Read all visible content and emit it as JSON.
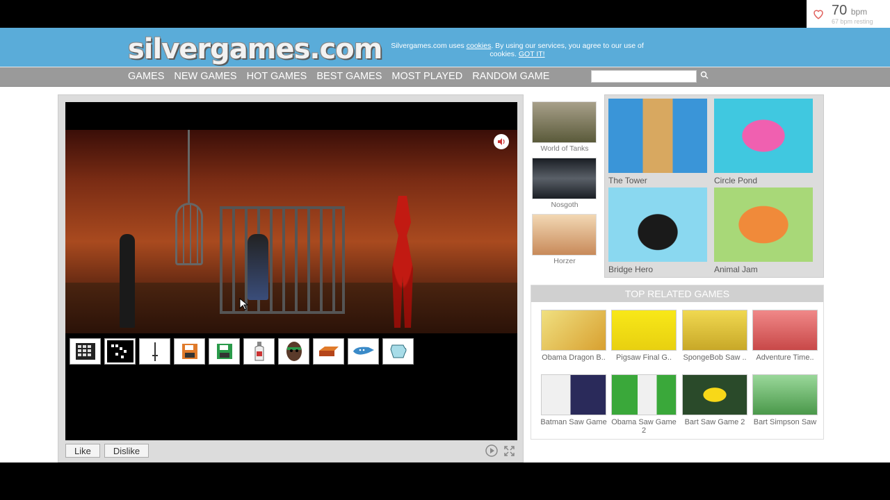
{
  "hr_widget": {
    "bpm": "70",
    "bpm_unit": "bpm",
    "resting": "67 bpm resting",
    "accent": "#e0605b"
  },
  "header": {
    "logo": "silvergames.com",
    "cookie_prefix": "Silvergames.com uses ",
    "cookie_link": "cookies",
    "cookie_middle": ". By using our services, you agree to our use of cookies.",
    "cookie_gotit": "GOT IT!"
  },
  "nav": {
    "items": [
      "GAMES",
      "NEW GAMES",
      "HOT GAMES",
      "BEST GAMES",
      "MOST PLAYED",
      "RANDOM GAME"
    ],
    "search_placeholder": ""
  },
  "game": {
    "like_label": "Like",
    "dislike_label": "Dislike",
    "inventory": [
      "grid-panel-icon",
      "crossword-icon",
      "knife-icon",
      "floppy-disk-orange-icon",
      "floppy-disk-green-icon",
      "bottle-icon",
      "mask-icon",
      "brick-icon",
      "ocarina-icon",
      "jug-icon"
    ]
  },
  "side_games": [
    {
      "label": "World of Tanks",
      "color": "#7a7d5c"
    },
    {
      "label": "Nosgoth",
      "color": "#3a4048"
    },
    {
      "label": "Horzer",
      "color": "#d9b08a"
    }
  ],
  "featured": [
    {
      "label": "The Tower",
      "color": "#4ba5e0"
    },
    {
      "label": "Circle Pond",
      "color": "#e84a9c"
    },
    {
      "label": "Bridge Hero",
      "color": "#7fcde8"
    },
    {
      "label": "Animal Jam",
      "color": "#e88a4a"
    }
  ],
  "related": {
    "title": "TOP RELATED GAMES",
    "items": [
      {
        "label": "Obama Dragon B..",
        "color": "#d9c46b"
      },
      {
        "label": "Pigsaw Final G..",
        "color": "#f0e020"
      },
      {
        "label": "SpongeBob Saw ..",
        "color": "#e8d24a"
      },
      {
        "label": "Adventure Time..",
        "color": "#e86a6a"
      },
      {
        "label": "Batman Saw Game",
        "color": "#2a2a4a"
      },
      {
        "label": "Obama Saw Game 2",
        "color": "#3aa83a"
      },
      {
        "label": "Bart Saw Game 2",
        "color": "#2a4a2a"
      },
      {
        "label": "Bart Simpson Saw",
        "color": "#6ab86a"
      }
    ]
  }
}
